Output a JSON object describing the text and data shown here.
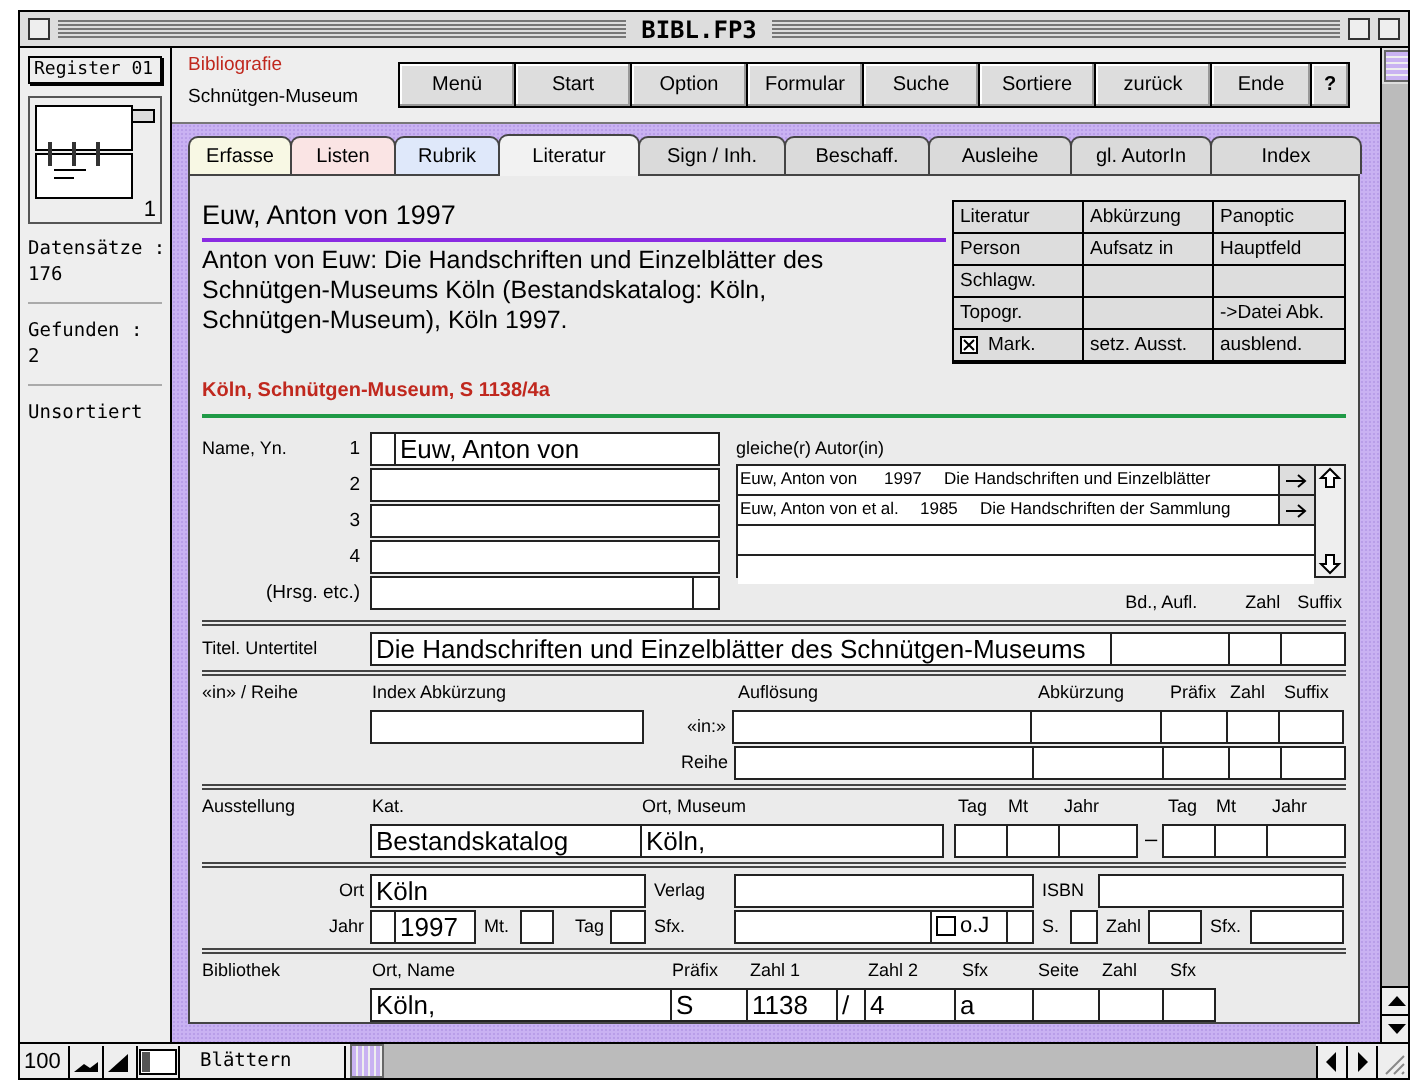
{
  "window": {
    "title": "BIBL.FP3"
  },
  "sidebar": {
    "layout": "Register 01",
    "record": "1",
    "records_label": "Datensätze :",
    "records": "176",
    "found_label": "Gefunden :",
    "found": "2",
    "sort": "Unsortiert"
  },
  "header": {
    "database": "Bibliografie",
    "institution": "Schnütgen-Museum"
  },
  "nav_buttons": [
    "Menü",
    "Start",
    "Option",
    "Formular",
    "Suche",
    "Sortiere",
    "zurück",
    "Ende",
    "?"
  ],
  "tabs": [
    {
      "label": "Erfasse",
      "selected": false,
      "color": "#f8f8e4"
    },
    {
      "label": "Listen",
      "selected": false,
      "color": "#fae4e4"
    },
    {
      "label": "Rubrik",
      "selected": false,
      "color": "#dfe8fa"
    },
    {
      "label": "Literatur",
      "selected": true,
      "color": "#f2f2f2"
    },
    {
      "label": "Sign / Inh.",
      "selected": false,
      "color": "#dadada"
    },
    {
      "label": "Beschaff.",
      "selected": false,
      "color": "#dadada"
    },
    {
      "label": "Ausleihe",
      "selected": false,
      "color": "#dadada"
    },
    {
      "label": "gl. AutorIn",
      "selected": false,
      "color": "#dadada"
    },
    {
      "label": "Index",
      "selected": false,
      "color": "#dadada"
    }
  ],
  "record": {
    "heading": "Euw, Anton von 1997",
    "citation": "Anton von Euw: Die Handschriften und Einzelblätter des Schnütgen-Museums Köln (Bestandskatalog: Köln, Schnütgen-Museum), Köln 1997.",
    "shelfmark": "Köln, Schnütgen-Museum, S 1138/4a"
  },
  "action_buttons": [
    {
      "kind": "button",
      "label": "Literatur"
    },
    {
      "kind": "button",
      "label": "Abkürzung"
    },
    {
      "kind": "button",
      "label": "Panoptic"
    },
    {
      "kind": "button",
      "label": "Person"
    },
    {
      "kind": "button",
      "label": "Aufsatz in"
    },
    {
      "kind": "button",
      "label": "Hauptfeld"
    },
    {
      "kind": "button",
      "label": "Schlagw."
    },
    {
      "kind": "empty"
    },
    {
      "kind": "empty"
    },
    {
      "kind": "button",
      "label": "Topogr."
    },
    {
      "kind": "empty"
    },
    {
      "kind": "button",
      "label": "->Datei Abk."
    },
    {
      "kind": "checkbox",
      "label": "Mark.",
      "checked": true
    },
    {
      "kind": "button",
      "label": "setz. Ausst."
    },
    {
      "kind": "button",
      "label": "ausblend."
    }
  ],
  "form": {
    "authors": {
      "label": "Name, Yn.",
      "numbers": [
        "1",
        "2",
        "3",
        "4"
      ],
      "first_name": "Euw, Anton von",
      "editor_label": "(Hrsg. etc.)"
    },
    "same_author": {
      "label": "gleiche(r) Autor(in)",
      "rows": [
        {
          "author": "Euw, Anton von",
          "year": "1997",
          "title": "Die Handschriften und Einzelblätter"
        },
        {
          "author": "Euw, Anton von et al.",
          "year": "1985",
          "title": "Die Handschriften der Sammlung"
        }
      ]
    },
    "volume_headers": [
      "Bd., Aufl.",
      "Zahl",
      "Suffix"
    ],
    "title": {
      "label": "Titel. Untertitel",
      "value": "Die Handschriften und Einzelblätter des Schnütgen-Museums"
    },
    "series": {
      "label": "«in» / Reihe",
      "index_header": "Index Abkürzung",
      "headers": [
        "Auflösung",
        "Abkürzung",
        "Präfix",
        "Zahl",
        "Suffix"
      ],
      "row_labels": [
        "«in:»",
        "Reihe"
      ]
    },
    "exhibition": {
      "label": "Ausstellung",
      "headers": [
        "Kat.",
        "Ort, Museum",
        "Tag",
        "Mt",
        "Jahr",
        "Tag",
        "Mt",
        "Jahr"
      ],
      "catalog": "Bestandskatalog",
      "place": "Köln,",
      "dash": "–"
    },
    "publication": {
      "place_label": "Ort",
      "place": "Köln",
      "publisher_label": "Verlag",
      "isbn_label": "ISBN",
      "year_label": "Jahr",
      "year": "1997",
      "month_label": "Mt.",
      "day_label": "Tag",
      "suffix_label": "Sfx.",
      "no_year": {
        "label": "o.J",
        "checked": false
      },
      "pages_label": "S.",
      "number_label": "Zahl",
      "suffix2_label": "Sfx."
    },
    "library": {
      "label": "Bibliothek",
      "headers": [
        "Ort, Name",
        "Präfix",
        "Zahl 1",
        "Zahl 2",
        "Sfx",
        "Seite",
        "Zahl",
        "Sfx"
      ],
      "place": "Köln,",
      "prefix": "S",
      "number_1": "1138",
      "slash": "/",
      "number_2": "4",
      "suffix": "a"
    }
  },
  "status_bar": {
    "zoom": "100",
    "mode": "Blättern"
  }
}
